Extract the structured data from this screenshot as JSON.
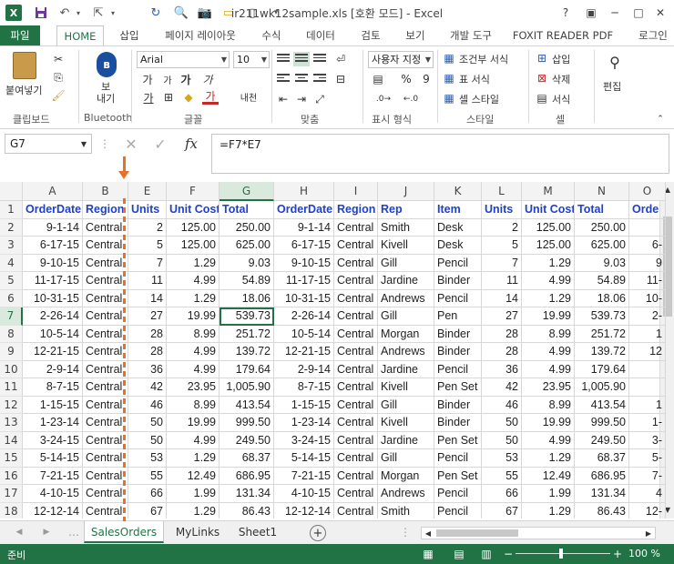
{
  "title": "ir211wk12sample.xls  [호환 모드] - Excel",
  "window_buttons": [
    "?",
    "▣",
    "─",
    "□",
    "✕"
  ],
  "tabs": [
    "파일",
    "HOME",
    "삽입",
    "페이지 레이아웃",
    "수식",
    "데이터",
    "검토",
    "보기",
    "개발 도구",
    "FOXIT READER PDF",
    "로그인"
  ],
  "ribbon": {
    "paste_label": "붙여넣기",
    "clipboard_group": "클립보드",
    "bluetooth_btn": "보\n내기",
    "bluetooth_group": "Bluetooth",
    "font_name": "Arial",
    "font_size": "10",
    "font_group": "글꼴",
    "align_group": "맞춤",
    "number_format": "사용자 지정",
    "number_group": "표시 형식",
    "cond_format": "조건부 서식",
    "table_format": "표 서식",
    "cell_style": "셀 스타일",
    "style_group": "스타일",
    "insert": "삽입",
    "delete": "삭제",
    "format": "서식",
    "cells_group": "셀",
    "edit": "편집",
    "bold": "가",
    "italic": "가",
    "underline": "가",
    "grow": "가",
    "shrink": "가",
    "phonetic": "내천",
    "percent": "%",
    "comma": "9"
  },
  "formula_bar": {
    "name_box": "G7",
    "formula": "=F7*E7",
    "fx": "fx"
  },
  "accent": "#217346",
  "header_color": "#1f40d0",
  "grid": {
    "columns": [
      "A",
      "B",
      "E",
      "F",
      "G",
      "H",
      "I",
      "J",
      "K",
      "L",
      "M",
      "N",
      "O"
    ],
    "rows": [
      "1",
      "2",
      "3",
      "4",
      "5",
      "6",
      "7",
      "8",
      "9",
      "10",
      "11",
      "12",
      "13",
      "14",
      "15",
      "16",
      "17",
      "18"
    ],
    "headers": [
      "OrderDate",
      "Region",
      "Units",
      "Unit Cost",
      "Total",
      "OrderDate",
      "Region",
      "Rep",
      "Item",
      "Units",
      "Unit Cost",
      "Total",
      "Orde"
    ],
    "data": [
      [
        "9-1-14",
        "Central",
        "2",
        "125.00",
        "250.00",
        "9-1-14",
        "Central",
        "Smith",
        "Desk",
        "2",
        "125.00",
        "250.00",
        ""
      ],
      [
        "6-17-15",
        "Central",
        "5",
        "125.00",
        "625.00",
        "6-17-15",
        "Central",
        "Kivell",
        "Desk",
        "5",
        "125.00",
        "625.00",
        "6-"
      ],
      [
        "9-10-15",
        "Central",
        "7",
        "1.29",
        "9.03",
        "9-10-15",
        "Central",
        "Gill",
        "Pencil",
        "7",
        "1.29",
        "9.03",
        "9"
      ],
      [
        "11-17-15",
        "Central",
        "11",
        "4.99",
        "54.89",
        "11-17-15",
        "Central",
        "Jardine",
        "Binder",
        "11",
        "4.99",
        "54.89",
        "11-"
      ],
      [
        "10-31-15",
        "Central",
        "14",
        "1.29",
        "18.06",
        "10-31-15",
        "Central",
        "Andrews",
        "Pencil",
        "14",
        "1.29",
        "18.06",
        "10-"
      ],
      [
        "2-26-14",
        "Central",
        "27",
        "19.99",
        "539.73",
        "2-26-14",
        "Central",
        "Gill",
        "Pen",
        "27",
        "19.99",
        "539.73",
        "2-"
      ],
      [
        "10-5-14",
        "Central",
        "28",
        "8.99",
        "251.72",
        "10-5-14",
        "Central",
        "Morgan",
        "Binder",
        "28",
        "8.99",
        "251.72",
        "1"
      ],
      [
        "12-21-15",
        "Central",
        "28",
        "4.99",
        "139.72",
        "12-21-15",
        "Central",
        "Andrews",
        "Binder",
        "28",
        "4.99",
        "139.72",
        "12"
      ],
      [
        "2-9-14",
        "Central",
        "36",
        "4.99",
        "179.64",
        "2-9-14",
        "Central",
        "Jardine",
        "Pencil",
        "36",
        "4.99",
        "179.64",
        ""
      ],
      [
        "8-7-15",
        "Central",
        "42",
        "23.95",
        "1,005.90",
        "8-7-15",
        "Central",
        "Kivell",
        "Pen Set",
        "42",
        "23.95",
        "1,005.90",
        ""
      ],
      [
        "1-15-15",
        "Central",
        "46",
        "8.99",
        "413.54",
        "1-15-15",
        "Central",
        "Gill",
        "Binder",
        "46",
        "8.99",
        "413.54",
        "1"
      ],
      [
        "1-23-14",
        "Central",
        "50",
        "19.99",
        "999.50",
        "1-23-14",
        "Central",
        "Kivell",
        "Binder",
        "50",
        "19.99",
        "999.50",
        "1-"
      ],
      [
        "3-24-15",
        "Central",
        "50",
        "4.99",
        "249.50",
        "3-24-15",
        "Central",
        "Jardine",
        "Pen Set",
        "50",
        "4.99",
        "249.50",
        "3-"
      ],
      [
        "5-14-15",
        "Central",
        "53",
        "1.29",
        "68.37",
        "5-14-15",
        "Central",
        "Gill",
        "Pencil",
        "53",
        "1.29",
        "68.37",
        "5-"
      ],
      [
        "7-21-15",
        "Central",
        "55",
        "12.49",
        "686.95",
        "7-21-15",
        "Central",
        "Morgan",
        "Pen Set",
        "55",
        "12.49",
        "686.95",
        "7-"
      ],
      [
        "4-10-15",
        "Central",
        "66",
        "1.99",
        "131.34",
        "4-10-15",
        "Central",
        "Andrews",
        "Pencil",
        "66",
        "1.99",
        "131.34",
        "4"
      ],
      [
        "12-12-14",
        "Central",
        "67",
        "1.29",
        "86.43",
        "12-12-14",
        "Central",
        "Smith",
        "Pencil",
        "67",
        "1.29",
        "86.43",
        "12-"
      ]
    ]
  },
  "sheets": [
    "SalesOrders",
    "MyLinks",
    "Sheet1"
  ],
  "status": {
    "ready": "준비",
    "zoom": "100 %"
  }
}
